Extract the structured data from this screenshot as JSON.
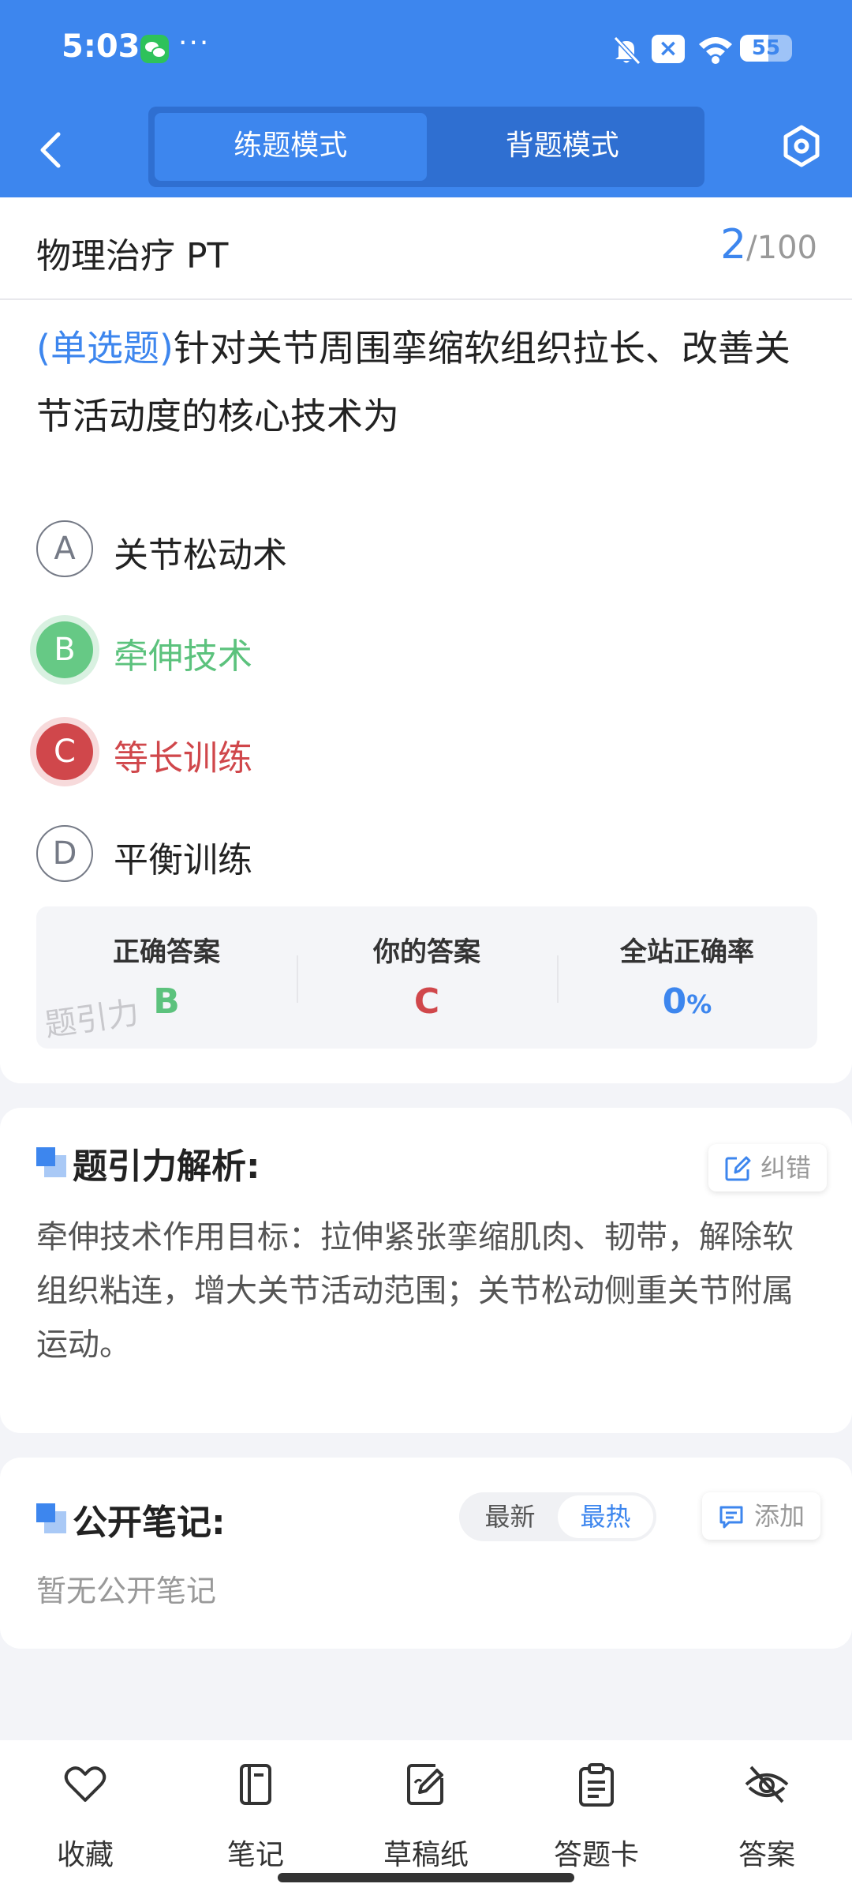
{
  "status_bar": {
    "time": "5:03",
    "battery": "55",
    "battery_level": 0.55,
    "dots": "···"
  },
  "nav": {
    "tabs": [
      {
        "label": "练题模式",
        "active": true
      },
      {
        "label": "背题模式",
        "active": false
      }
    ]
  },
  "question": {
    "subject": "物理治疗 PT",
    "current": "2",
    "total": "/100",
    "type_label": "(单选题)",
    "text": "针对关节周围挛缩软组织拉长、改善关节活动度的核心技术为",
    "options": [
      {
        "letter": "A",
        "text": "关节松动术",
        "state": "normal"
      },
      {
        "letter": "B",
        "text": "牵伸技术",
        "state": "correct"
      },
      {
        "letter": "C",
        "text": "等长训练",
        "state": "wrong"
      },
      {
        "letter": "D",
        "text": "平衡训练",
        "state": "normal"
      }
    ]
  },
  "stats": {
    "correct_label": "正确答案",
    "correct_value": "B",
    "yours_label": "你的答案",
    "yours_value": "C",
    "rate_label": "全站正确率",
    "rate_value": "0",
    "rate_unit": "%",
    "watermark": "题引力"
  },
  "analysis": {
    "title": "题引力解析:",
    "report_label": "纠错",
    "text": "牵伸技术作用目标：拉伸紧张挛缩肌肉、韧带，解除软组织粘连，增大关节活动范围；关节松动侧重关节附属运动。"
  },
  "notes": {
    "title": "公开笔记:",
    "sort_latest": "最新",
    "sort_hot": "最热",
    "add_label": "添加",
    "empty": "暂无公开笔记"
  },
  "bottom_bar": {
    "items": [
      "收藏",
      "笔记",
      "草稿纸",
      "答题卡",
      "答案"
    ]
  },
  "colors": {
    "primary": "#3d86ee",
    "correct": "#5cc27d",
    "wrong": "#d0474b"
  }
}
